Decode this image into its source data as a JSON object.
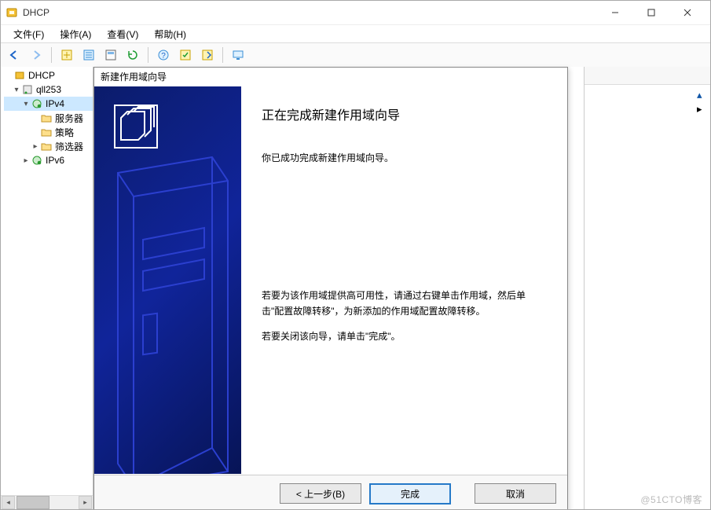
{
  "window": {
    "title": "DHCP"
  },
  "menu": {
    "file": "文件(F)",
    "action": "操作(A)",
    "view": "查看(V)",
    "help": "帮助(H)"
  },
  "tree": {
    "root": "DHCP",
    "server": "qll253",
    "ipv4": "IPv4",
    "ipv4_children": {
      "server_opts": "服务器",
      "policies": "策略",
      "filters": "筛选器"
    },
    "ipv6": "IPv6"
  },
  "wizard": {
    "title": "新建作用域向导",
    "heading": "正在完成新建作用域向导",
    "line1": "你已成功完成新建作用域向导。",
    "line2": "若要为该作用域提供高可用性，请通过右键单击作用域，然后单击\"配置故障转移\"，为新添加的作用域配置故障转移。",
    "line3": "若要关闭该向导，请单击\"完成\"。",
    "buttons": {
      "back": "< 上一步(B)",
      "finish": "完成",
      "cancel": "取消"
    }
  },
  "watermark": "@51CTO博客"
}
